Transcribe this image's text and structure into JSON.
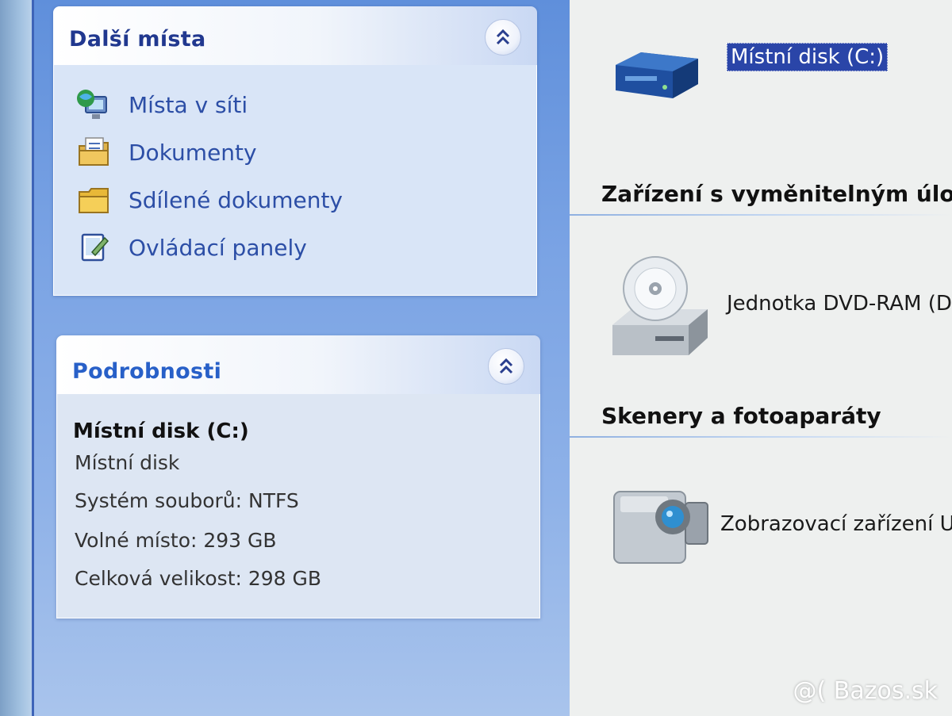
{
  "other_places": {
    "title": "Další místa",
    "items": [
      {
        "label": "Místa v síti",
        "icon": "network-places-icon"
      },
      {
        "label": "Dokumenty",
        "icon": "documents-icon"
      },
      {
        "label": "Sdílené dokumenty",
        "icon": "shared-folder-icon"
      },
      {
        "label": "Ovládací panely",
        "icon": "control-panel-icon"
      }
    ]
  },
  "details": {
    "title": "Podrobnosti",
    "name": "Místní disk (C:)",
    "type": "Místní disk",
    "filesystem": "Systém souborů: NTFS",
    "free_space": "Volné místo: 293 GB",
    "total_size": "Celková velikost: 298 GB"
  },
  "content": {
    "local_disk": {
      "label": "Místní disk (C:)",
      "icon": "hard-disk-icon"
    },
    "removable_group": "Zařízení s vyměnitelným úlo",
    "dvd_drive": {
      "label": "Jednotka DVD-RAM (D",
      "icon": "dvd-drive-icon"
    },
    "scanners_group": "Skenery a fotoaparáty",
    "camera": {
      "label": "Zobrazovací zařízení US",
      "icon": "camera-icon"
    }
  },
  "watermark": "@( Bazos.sk",
  "colors": {
    "task_pane_blue": "#6f9be0",
    "panel_title": "#21388f",
    "link": "#2c4ea6",
    "selection": "#2a45a8"
  }
}
